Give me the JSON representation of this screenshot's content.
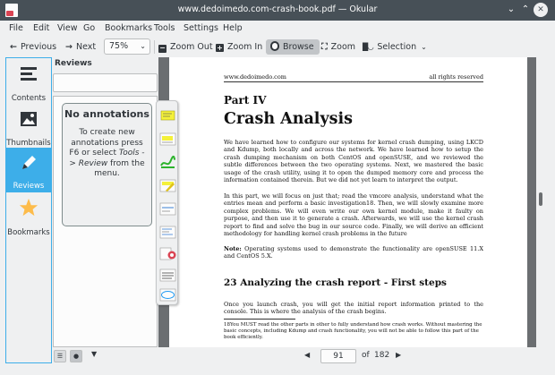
{
  "window": {
    "title": "www.dedoimedo.com-crash-book.pdf — Okular"
  },
  "menu": [
    "File",
    "Edit",
    "View",
    "Go",
    "Bookmarks",
    "Tools",
    "Settings",
    "Help"
  ],
  "toolbar": {
    "previous_label": "Previous",
    "next_label": "Next",
    "zoom_value": "75%",
    "zoom_out_label": "Zoom Out",
    "zoom_in_label": "Zoom In",
    "browse_label": "Browse",
    "zoom_label": "Zoom",
    "selection_label": "Selection"
  },
  "sidebar": {
    "tabs": [
      {
        "label": "Contents",
        "icon": "contents-icon"
      },
      {
        "label": "Thumbnails",
        "icon": "thumbnails-icon"
      },
      {
        "label": "Reviews",
        "icon": "reviews-icon"
      },
      {
        "label": "Bookmarks",
        "icon": "bookmarks-icon"
      }
    ],
    "active_tab": "Reviews",
    "accent_color": "#3daee9"
  },
  "reviews_panel": {
    "title": "Reviews",
    "search_value": "",
    "empty_heading": "No annotations",
    "empty_text_1": "To create new annotations press F6 or select ",
    "empty_text_italic": "Tools -> Review",
    "empty_text_2": " from the menu."
  },
  "document": {
    "header_left": "www.dedoimedo.com",
    "header_right": "all rights reserved",
    "part": "Part IV",
    "title": "Crash Analysis",
    "para1": "We have learned how to configure our systems for kernel crash dumping, using LKCD and Kdump, both locally and across the network. We have learned how to setup the crash dumping mechanism on both CentOS and openSUSE, and we reviewed the subtle differences between the two operating systems. Next, we mastered the basic usage of the crash utility, using it to open the dumped memory core and process the information contained therein. But we did not yet learn to interpret the output.",
    "para2": "In this part, we will focus on just that; read the vmcore analysis, understand what the entries mean and perform a basic investigation18. Then, we will slowly examine more complex problems. We will even write our own kernel module, make it faulty on purpose, and then use it to generate a crash. Afterwards, we will use the kernel crash report to find and solve the bug in our source code. Finally, we will derive an efficient methodology for handling kernel crash problems in the future",
    "note_label": "Note:",
    "note_text": " Operating systems used to demonstrate the functionality are openSUSE 11.X and CentOS 5.X.",
    "section": "23   Analyzing the crash report - First steps",
    "para3": "Once you launch crash, you will get the initial report information printed to the console. This is where the analysis of the crash begins.",
    "footnote": "18You MUST read the other parts in other to fully understand how crash works. Without mastering the basic concepts, including Kdump and crash functionality, you will not be able to follow this part of the book efficiently."
  },
  "navigation": {
    "current_page": "91",
    "of_label": "of",
    "total_pages": "182"
  }
}
